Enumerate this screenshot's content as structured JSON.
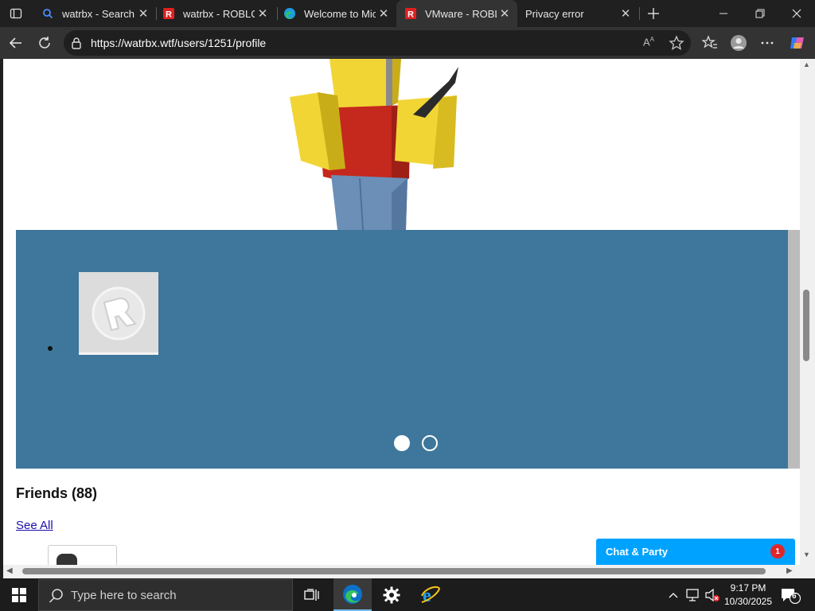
{
  "browser": {
    "tabs": [
      {
        "label": "watrbx - Search",
        "icon": "search-icon",
        "active": false
      },
      {
        "label": "watrbx - ROBLOX",
        "icon": "roblox-logo-icon",
        "active": false
      },
      {
        "label": "Welcome to Micr",
        "icon": "edge-logo-icon",
        "active": false
      },
      {
        "label": "VMware - ROBLO",
        "icon": "roblox-logo-icon",
        "active": true
      },
      {
        "label": "Privacy error",
        "icon": "",
        "active": false
      }
    ],
    "url": "https://watrbx.wtf/users/1251/profile",
    "read_aloud_label": "A",
    "colors": {
      "tab_bg": "#202020",
      "toolbar_bg": "#333333",
      "omnibox_bg": "#1f1f1f"
    }
  },
  "page": {
    "friends_title": "Friends (88)",
    "see_all_label": "See All",
    "carousel": {
      "background": "#3e779b",
      "pages": 2,
      "active_page": 1
    },
    "chat_party": {
      "label": "Chat & Party",
      "badge": "1",
      "color": "#00a2ff"
    }
  },
  "taskbar": {
    "search_placeholder": "Type here to search",
    "apps": [
      "task-view-icon",
      "edge-icon",
      "settings-icon",
      "internet-explorer-icon"
    ],
    "time": "9:17 PM",
    "date": "10/30/2025",
    "notifications_count": "6"
  }
}
